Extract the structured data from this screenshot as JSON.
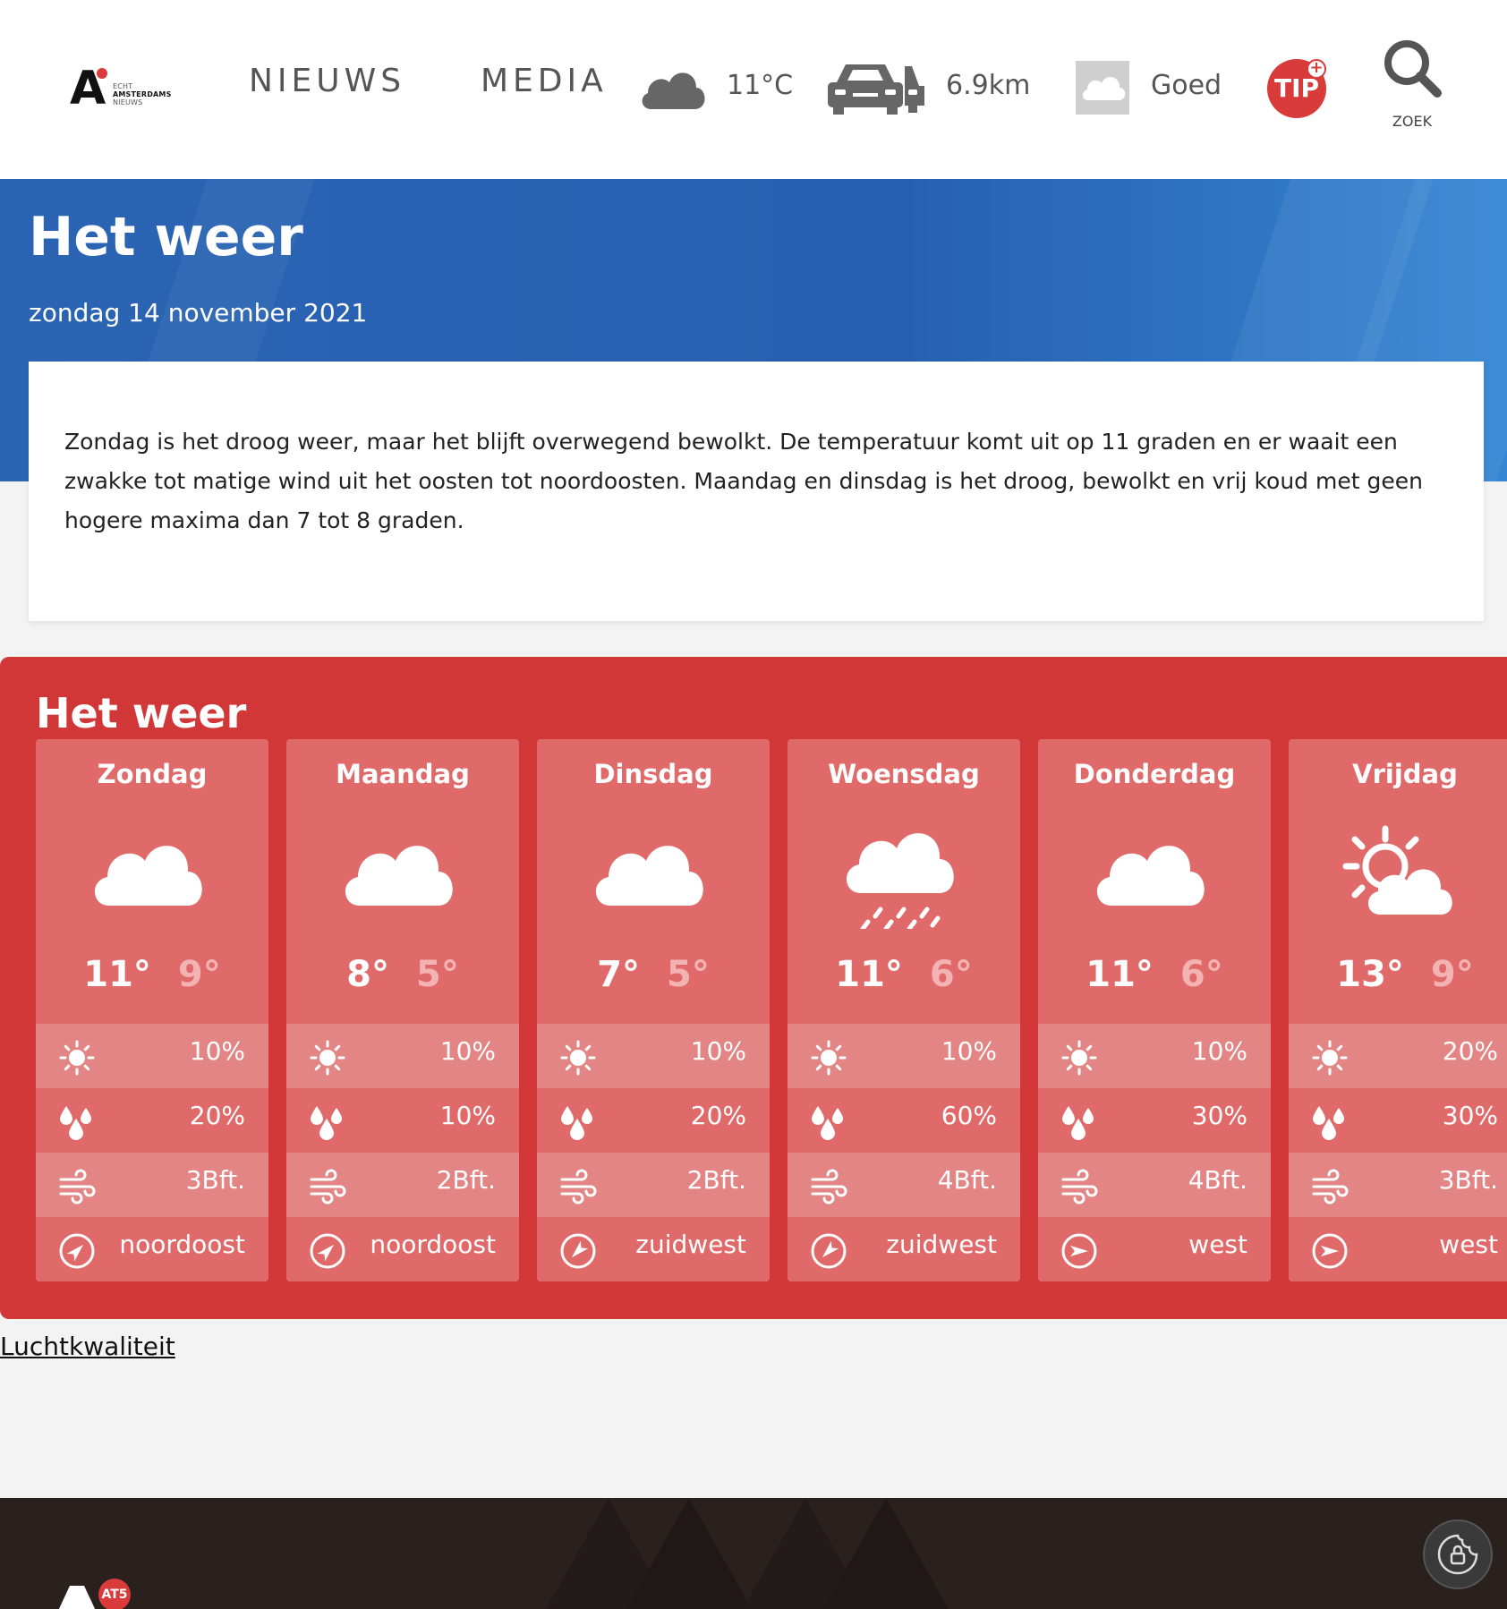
{
  "header": {
    "logo": {
      "letter": "A",
      "line1": "ECHT",
      "line2": "AMSTERDAMS",
      "line3": "NIEUWS"
    },
    "nav": [
      {
        "label": "NIEUWS"
      },
      {
        "label": "MEDIA"
      }
    ],
    "weather": {
      "icon": "cloud-icon",
      "temp": "11°C"
    },
    "traffic": {
      "icon": "cars-icon",
      "value": "6.9km"
    },
    "air_quality": {
      "icon": "cloud-icon",
      "value": "Goed"
    },
    "tip": {
      "label": "TIP",
      "plus": "+"
    },
    "search": {
      "icon": "search-icon",
      "label": "ZOEK"
    }
  },
  "hero": {
    "title": "Het weer",
    "date": "zondag 14 november 2021",
    "summary": "Zondag is het droog weer, maar het blijft overwegend bewolkt. De temperatuur komt uit op 11 graden en er waait een zwakke tot matige wind uit het oosten tot noordoosten. Maandag en dinsdag is het droog, bewolkt en vrij koud met geen hogere maxima dan 7 tot 8 graden."
  },
  "forecast": {
    "title": "Het weer",
    "days": [
      {
        "name": "Zondag",
        "icon": "cloud-icon",
        "max": "11°",
        "min": "9°",
        "sun": "10%",
        "rain": "20%",
        "wind": "3Bft.",
        "direction": "noordoost"
      },
      {
        "name": "Maandag",
        "icon": "cloud-icon",
        "max": "8°",
        "min": "5°",
        "sun": "10%",
        "rain": "10%",
        "wind": "2Bft.",
        "direction": "noordoost"
      },
      {
        "name": "Dinsdag",
        "icon": "cloud-icon",
        "max": "7°",
        "min": "5°",
        "sun": "10%",
        "rain": "20%",
        "wind": "2Bft.",
        "direction": "zuidwest"
      },
      {
        "name": "Woensdag",
        "icon": "rain-cloud-icon",
        "max": "11°",
        "min": "6°",
        "sun": "10%",
        "rain": "60%",
        "wind": "4Bft.",
        "direction": "zuidwest"
      },
      {
        "name": "Donderdag",
        "icon": "cloud-icon",
        "max": "11°",
        "min": "6°",
        "sun": "10%",
        "rain": "30%",
        "wind": "4Bft.",
        "direction": "west"
      },
      {
        "name": "Vrijdag",
        "icon": "sun-cloud-icon",
        "max": "13°",
        "min": "9°",
        "sun": "20%",
        "rain": "30%",
        "wind": "3Bft.",
        "direction": "west"
      }
    ]
  },
  "links": {
    "luchtkwaliteit": "Luchtkwaliteit"
  },
  "footer": {
    "logo_letter": "A",
    "badge": "AT5"
  },
  "colors": {
    "hero_blue": "#2760b0",
    "forecast_red": "#d23737",
    "card_red": "#e06a6a",
    "footer_dark": "#2a211f"
  }
}
